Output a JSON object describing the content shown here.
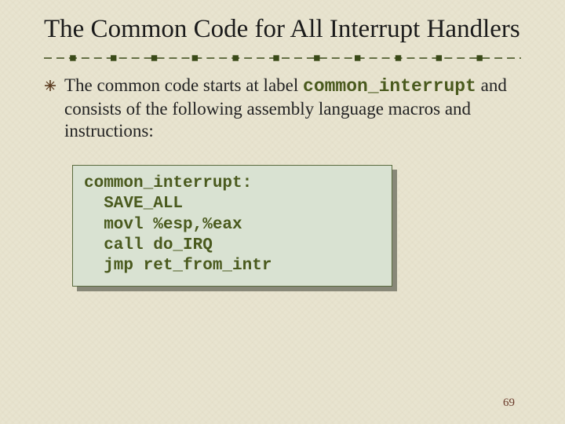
{
  "title": "The Common Code for All Interrupt Handlers",
  "body": {
    "pre": "The common code starts at label ",
    "code_label": "common_interrupt",
    "post": " and consists of the following assembly language macros and instructions:"
  },
  "code_block": "common_interrupt:\n  SAVE_ALL\n  movl %esp,%eax\n  call do_IRQ\n  jmp ret_from_intr",
  "page_number": "69",
  "colors": {
    "accent_olive": "#4a5a1e",
    "code_bg": "#d9e2d2",
    "divider": "#3a4a18"
  }
}
